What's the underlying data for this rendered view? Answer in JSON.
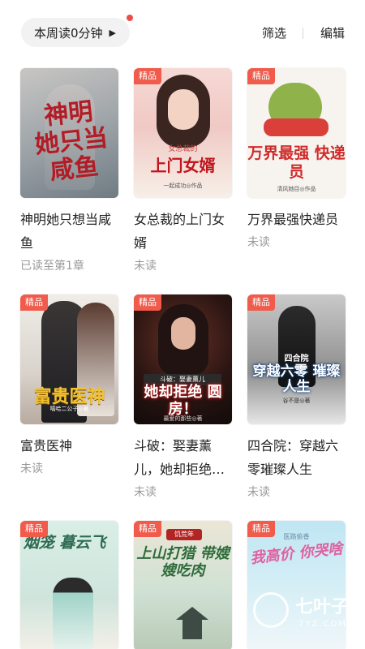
{
  "header": {
    "weekly_read": "本周读0分钟",
    "arrow": "▶",
    "filter": "筛选",
    "edit": "编辑"
  },
  "badge_label": "精品",
  "books": [
    {
      "title": "神明她只想当咸鱼",
      "status": "已读至第1章",
      "cover_title": "神明 她只当咸鱼"
    },
    {
      "title": "女总裁的上门女婿",
      "status": "未读",
      "cover_sub": "女总裁的",
      "cover_title": "上门女婿",
      "cover_author": "一起成功◎作品"
    },
    {
      "title": "万界最强快递员",
      "status": "未读",
      "cover_title": "万界最强 快递员",
      "cover_author": "清风她目◎作品"
    },
    {
      "title": "富贵医神",
      "status": "未读",
      "cover_title": "富贵医神",
      "cover_author": "嘻哈二公子◎著"
    },
    {
      "title": "斗破：娶妻薰儿，她却拒绝圆房！",
      "status": "未读",
      "cover_sub": "斗破：娶妻薰儿",
      "cover_title": "她却拒绝 圆房！",
      "cover_author": "最爱的那些◎著"
    },
    {
      "title": "四合院：穿越六零璀璨人生",
      "status": "未读",
      "cover_sub": "四合院",
      "cover_title": "穿越六零 璀璨人生",
      "cover_author": "谷不是◎著"
    },
    {
      "title": "",
      "status": "",
      "cover_title": "烟笼 暮云飞"
    },
    {
      "title": "",
      "status": "",
      "cover_sub": "饥荒年",
      "cover_title": "上山打猎 带嫂嫂吃肉"
    },
    {
      "title": "",
      "status": "",
      "cover_sub": "医路偷香",
      "cover_title": "我高价 你哭啥"
    }
  ],
  "watermark": {
    "name": "七叶子",
    "domain": "7YZ.COM"
  }
}
